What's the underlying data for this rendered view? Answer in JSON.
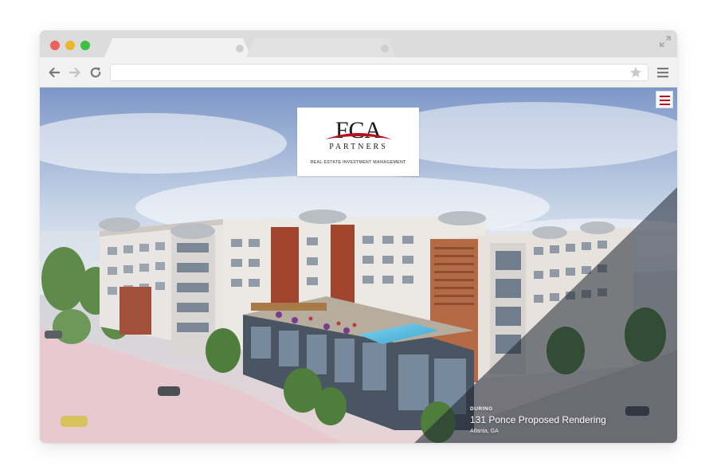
{
  "logo": {
    "brand": "FCA",
    "wordmark": "PARTNERS",
    "tagline": "REAL ESTATE INVESTMENT MANAGEMENT"
  },
  "address_bar": {
    "value": ""
  },
  "slide": {
    "phase": "DURING",
    "title": "131 Ponce Proposed Rendering",
    "location": "Atlanta, GA"
  },
  "icons": {
    "back": "arrow-left-icon",
    "forward": "arrow-right-icon",
    "reload": "reload-icon",
    "bookmark": "star-icon",
    "browser_menu": "hamburger-icon",
    "site_menu": "hamburger-menu-icon",
    "expand": "expand-icon"
  },
  "colors": {
    "accent_red": "#b8101f",
    "window_close": "#f0605a",
    "window_minimize": "#e9b62e",
    "window_maximize": "#3dc142"
  }
}
